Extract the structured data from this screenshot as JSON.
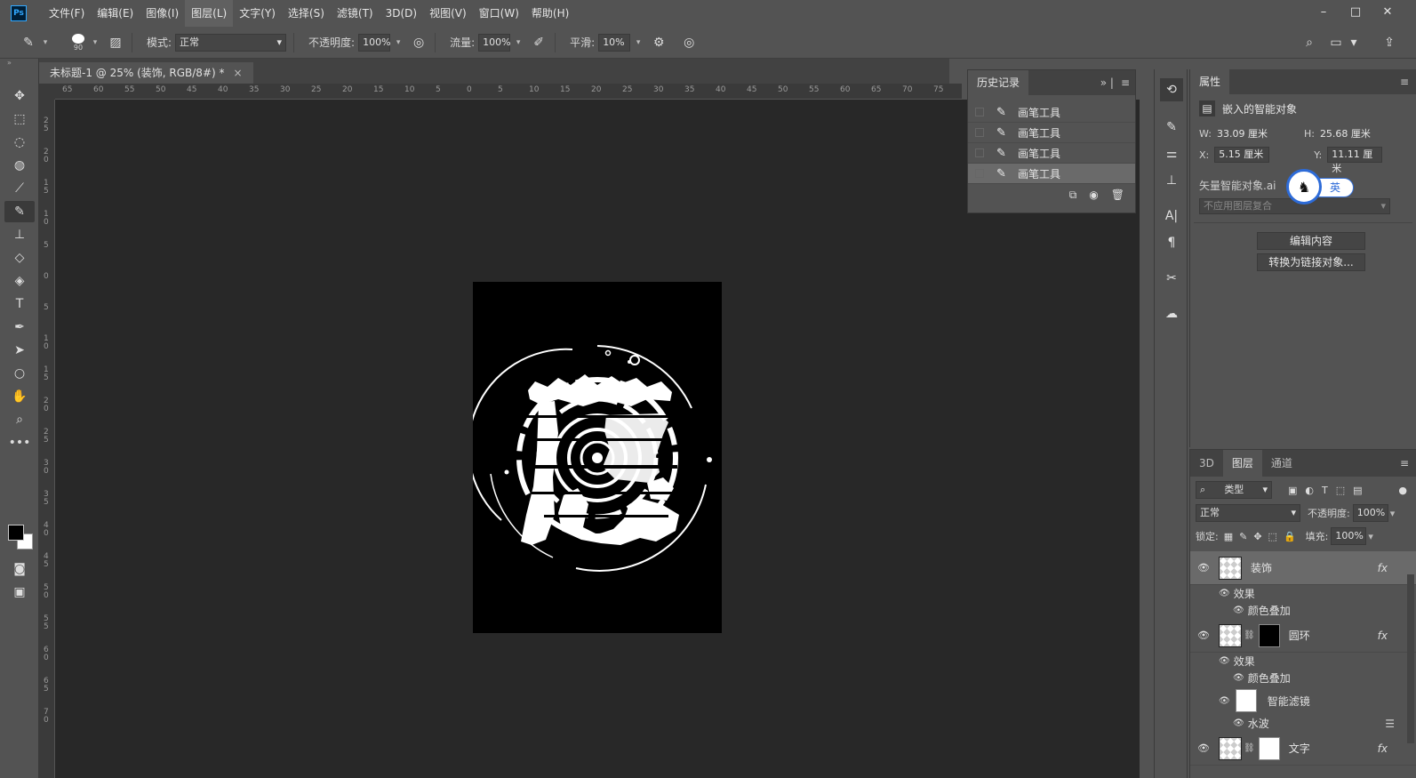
{
  "menubar": {
    "logo": "Ps",
    "items": [
      "文件(F)",
      "编辑(E)",
      "图像(I)",
      "图层(L)",
      "文字(Y)",
      "选择(S)",
      "滤镜(T)",
      "3D(D)",
      "视图(V)",
      "窗口(W)",
      "帮助(H)"
    ],
    "window_controls": [
      "–",
      "□",
      "✕"
    ]
  },
  "options": {
    "brush_size": "90",
    "mode_label": "模式:",
    "mode_value": "正常",
    "opacity_label": "不透明度:",
    "opacity_value": "100%",
    "flow_label": "流量:",
    "flow_value": "100%",
    "smooth_label": "平滑:",
    "smooth_value": "10%"
  },
  "document": {
    "tab_title": "未标题-1 @ 25% (装饰, RGB/8#) *",
    "tab_close": "×"
  },
  "ruler": {
    "top_ticks": [
      "65",
      "60",
      "55",
      "50",
      "45",
      "40",
      "35",
      "30",
      "25",
      "20",
      "15",
      "10",
      "5",
      "0",
      "5",
      "10",
      "15",
      "20",
      "25",
      "30",
      "35",
      "40",
      "45",
      "50",
      "55",
      "60",
      "65",
      "70",
      "75"
    ],
    "left_ticks": [
      "2\n5",
      "2\n0",
      "1\n5",
      "1\n0",
      "5",
      "0",
      "5",
      "1\n0",
      "1\n5",
      "2\n0",
      "2\n5",
      "3\n0",
      "3\n5",
      "4\n0",
      "4\n5",
      "5\n0",
      "5\n5",
      "6\n0",
      "6\n5",
      "7\n0"
    ]
  },
  "history": {
    "title": "历史记录",
    "items": [
      "画笔工具",
      "画笔工具",
      "画笔工具",
      "画笔工具"
    ]
  },
  "properties": {
    "title": "属性",
    "object_type": "嵌入的智能对象",
    "w_label": "W:",
    "w_value": "33.09 厘米",
    "h_label": "H:",
    "h_value": "25.68 厘米",
    "x_label": "X:",
    "x_value": "5.15 厘米",
    "y_label": "Y:",
    "y_value": "11.11 厘米",
    "file_name": "矢量智能对象.ai",
    "comp_placeholder": "不应用图层复合",
    "edit_button": "编辑内容",
    "convert_button": "转换为链接对象..."
  },
  "ime": {
    "label": "英"
  },
  "layers": {
    "tabs": [
      "3D",
      "图层",
      "通道"
    ],
    "filter_value": "类型",
    "blend_mode": "正常",
    "opacity_label": "不透明度:",
    "opacity_value": "100%",
    "lock_label": "锁定:",
    "fill_label": "填充:",
    "fill_value": "100%",
    "items": [
      {
        "name": "装饰",
        "effects_label": "效果",
        "effect": "颜色叠加"
      },
      {
        "name": "圆环",
        "effects_label": "效果",
        "effect": "颜色叠加",
        "smart_filter": "智能滤镜",
        "filter": "水波"
      },
      {
        "name": "文字"
      }
    ],
    "fx_label": "fx"
  }
}
